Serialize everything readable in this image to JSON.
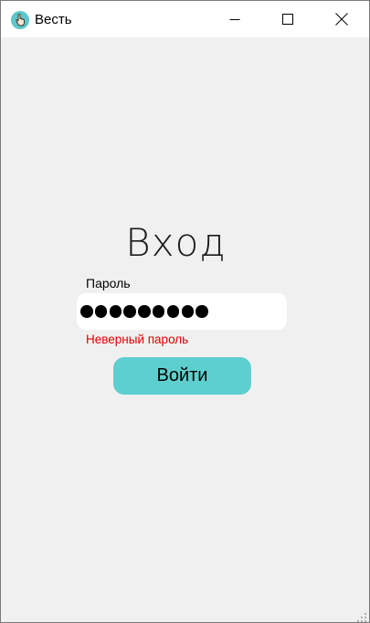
{
  "window": {
    "title": "Весть",
    "app_icon": "hand-pointer-icon",
    "controls": [
      "minimize-icon",
      "maximize-icon",
      "close-icon"
    ]
  },
  "login": {
    "heading": "Вход",
    "password_label": "Пароль",
    "password_masked_length": 9,
    "error_message": "Неверный пароль",
    "submit_label": "Войти"
  },
  "colors": {
    "background": "#f0f0f0",
    "titlebar": "#ffffff",
    "input_background": "#ffffff",
    "button": "#5ecfcf",
    "error": "#e00000"
  }
}
